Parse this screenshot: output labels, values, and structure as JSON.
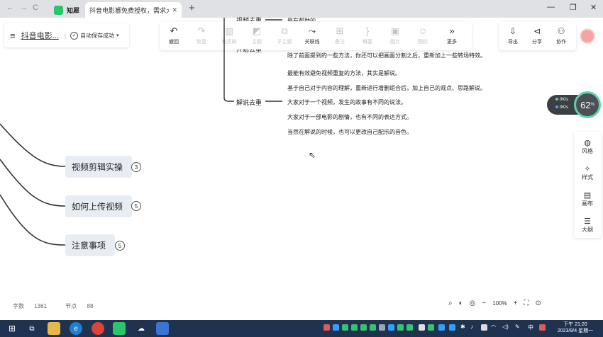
{
  "browser": {
    "nav": {
      "back": "←",
      "forward": "→",
      "reload": "C"
    },
    "tabs": [
      {
        "label": "知犀",
        "active": false
      },
      {
        "label": "抖音电影篡免费授权，需求大...",
        "active": true
      }
    ],
    "close_glyph": "✕",
    "new_tab": "+",
    "window": {
      "minimize": "—",
      "maximize": "❐",
      "close": "✕"
    }
  },
  "header": {
    "menu_icon": "≡",
    "doc_title": "抖音电影...",
    "separator": "|",
    "autosave": "自动保存成功",
    "dropdown": "▾"
  },
  "toolbar": {
    "items": [
      {
        "label": "撤回",
        "icon": "↶",
        "enabled": true
      },
      {
        "label": "恢复",
        "icon": "↷",
        "enabled": false
      },
      {
        "label": "格式刷",
        "icon": "▥",
        "enabled": false
      },
      {
        "label": "主题",
        "icon": "◩",
        "enabled": false
      },
      {
        "label": "子主题",
        "icon": "⧉",
        "enabled": false
      },
      {
        "label": "关联线",
        "icon": "⤳",
        "enabled": true
      },
      {
        "label": "备注",
        "icon": "⊞",
        "enabled": false
      },
      {
        "label": "概要",
        "icon": "}",
        "enabled": false
      },
      {
        "label": "图片",
        "icon": "▣",
        "enabled": false
      },
      {
        "label": "图标",
        "icon": "☺",
        "enabled": false
      },
      {
        "label": "更多",
        "icon": "»",
        "enabled": true
      }
    ]
  },
  "right_toolbar": {
    "items": [
      {
        "label": "导出",
        "icon": "⇩"
      },
      {
        "label": "分享",
        "icon": "⊲"
      },
      {
        "label": "协作",
        "icon": "⚇"
      }
    ]
  },
  "mindmap": {
    "partial_top": {
      "sub_label": "视频去重",
      "text": "最有帮助的",
      "sub_label2": "开始去重"
    },
    "branch": {
      "label": "解说去重",
      "paragraphs": [
        "除了前面提到的一些方法，你还可以把画面分割之后，重新加上一些转场特效。",
        "最能有效避免视频重复的方法，其实是解说。",
        "基于自己对于内容的理解，重新进行增删组合后，加上自己的观点、思路解说。",
        "大家对于一个视频，发生的故事有不同的说法。",
        "大家对于一部电影的剧情，也有不同的表达方式。",
        "当然在解说的时候，也可以更改自己配乐的音色。"
      ]
    },
    "nodes": [
      {
        "label": "视频剪辑实操",
        "count": "3"
      },
      {
        "label": "如何上传视频",
        "count": "5"
      },
      {
        "label": "注意事项",
        "count": "5"
      }
    ]
  },
  "speed_widget": {
    "up": "0K/s",
    "down": "0K/s",
    "percent": "62",
    "unit": "%",
    "colors": {
      "up": "#5fd1a7",
      "down": "#4fa3ff"
    }
  },
  "side_panel": {
    "items": [
      {
        "label": "风格",
        "icon": "◍"
      },
      {
        "label": "样式",
        "icon": "✧"
      },
      {
        "label": "画布",
        "icon": "▤"
      },
      {
        "label": "大纲",
        "icon": "☰"
      }
    ]
  },
  "footer": {
    "word_count_label": "字数",
    "word_count": "1361",
    "node_count_label": "节点",
    "node_count": "88",
    "zoom": "100%",
    "zoom_minus": "−",
    "zoom_plus": "+"
  },
  "taskbar": {
    "ime": "中",
    "time": "下午 21:20",
    "date": "2023/9/4 星期一"
  }
}
